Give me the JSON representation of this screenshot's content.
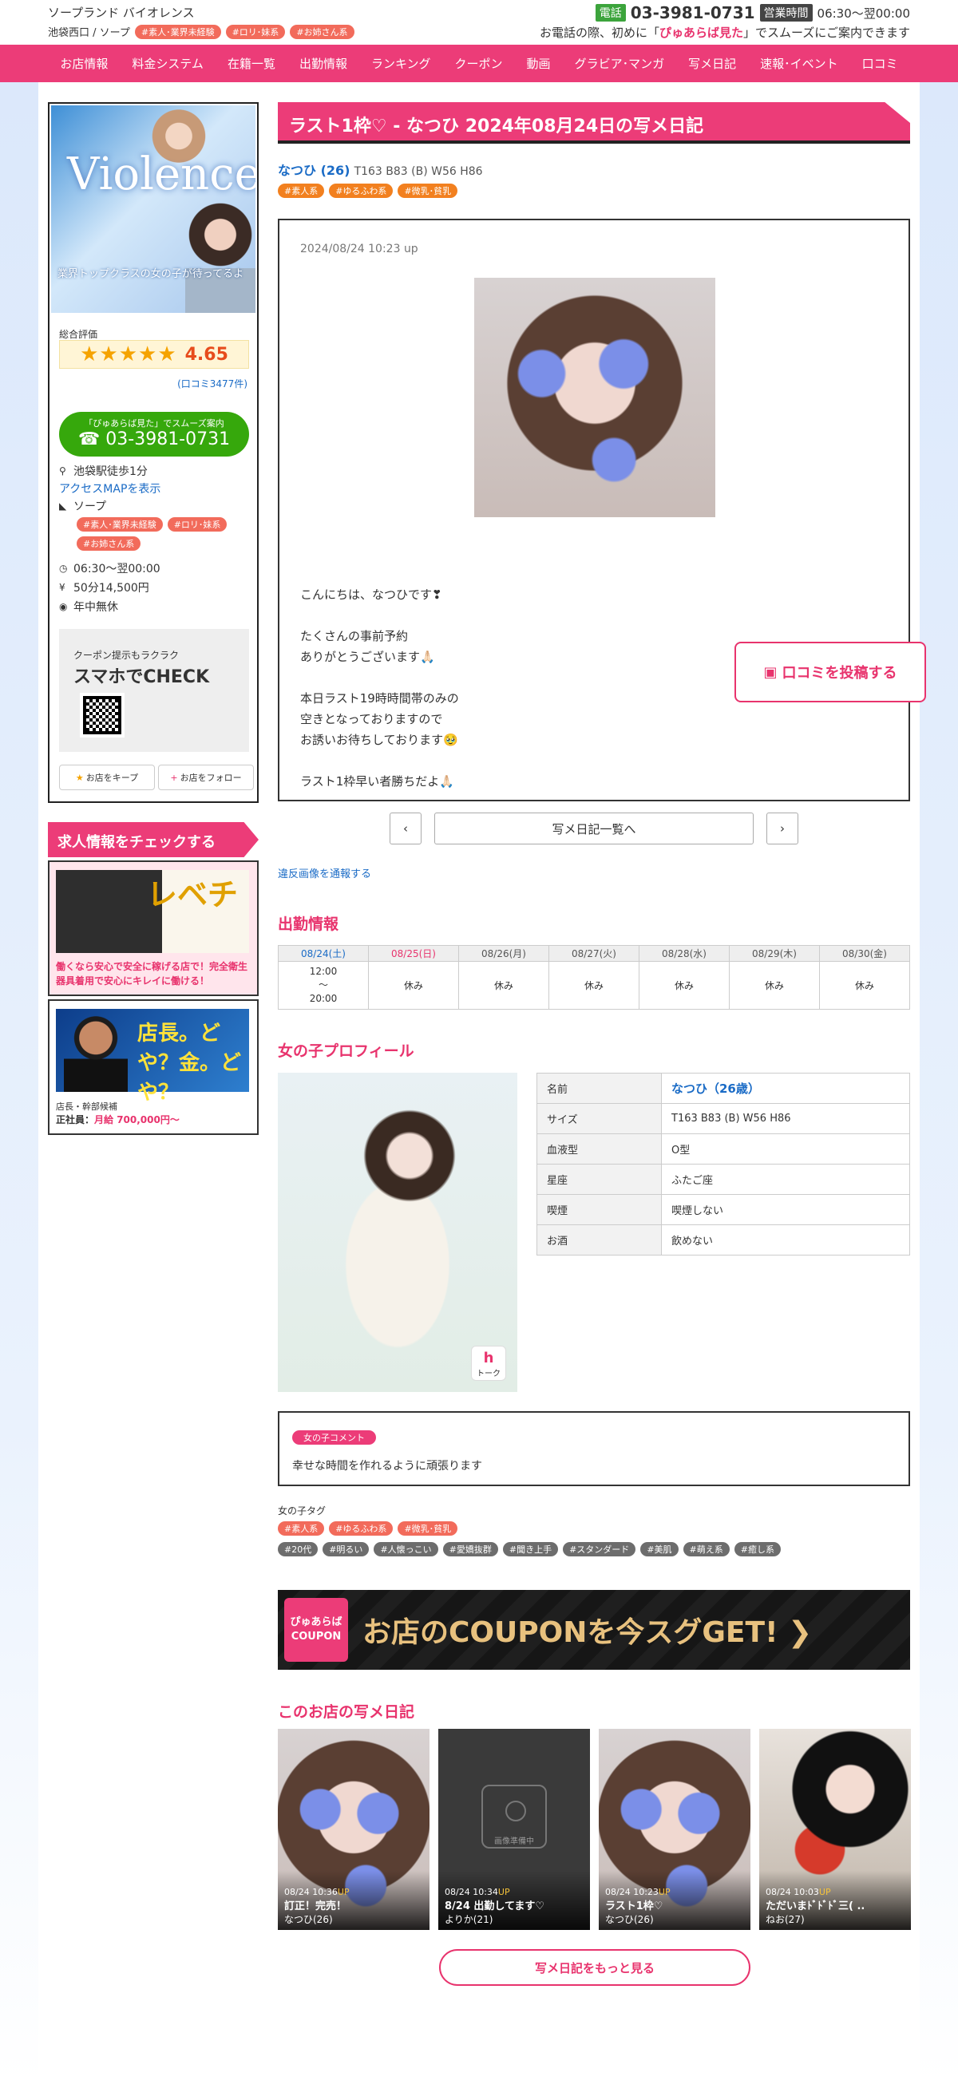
{
  "header": {
    "shop_title": "ソープランド バイオレンス",
    "shop_sub": "池袋西口 / ソープ",
    "shop_tags": [
      "#素人･業界未経験",
      "#ロリ･妹系",
      "#お姉さん系"
    ],
    "tel_label": "電話",
    "tel": "03-3981-0731",
    "hours_label": "営業時間",
    "hours": "06:30〜翌00:00",
    "notice_pre": "お電話の際、初めに「",
    "notice_key": "ぴゅあらば見た",
    "notice_post": "」でスムーズにご案内できます"
  },
  "nav": [
    "お店情報",
    "料金システム",
    "在籍一覧",
    "出勤情報",
    "ランキング",
    "クーポン",
    "動画",
    "グラビア･マンガ",
    "写メ日記",
    "速報･イベント",
    "口コミ"
  ],
  "sidebar": {
    "banner_logo": "Violence",
    "banner_caption": "業界トップクラスの女の子が待ってるよ",
    "eval_label": "総合評価",
    "stars": "★★★★★",
    "score": "4.65",
    "reviews": "(口コミ3477件)",
    "tel_small": "「ぴゅあらば見た」でスムーズ案内",
    "tel": "03-3981-0731",
    "access": "池袋駅徒歩1分",
    "map_link": "アクセスMAPを表示",
    "genre": "ソープ",
    "tags": [
      "#素人･業界未経験",
      "#ロリ･妹系",
      "#お姉さん系"
    ],
    "hours": "06:30〜翌00:00",
    "price": "50分14,500円",
    "holiday": "年中無休",
    "coupon_small": "クーポン提示もラクラク",
    "coupon_big": "スマホでCHECK",
    "keep": "お店をキープ",
    "follow": "お店をフォロー"
  },
  "recruit": {
    "title": "求人情報をチェックする",
    "card1_big": "レベチ",
    "card1_text": "働くなら安心で安全に稼げる店で！完全衛生器具着用で安心にキレイに働ける！",
    "card2_big": "店長。どや？金。どや？",
    "card2_role": "店長・幹部候補",
    "card2_pay_label": "正社員：",
    "card2_pay": "月給 700,000円〜"
  },
  "diary": {
    "title": "ラスト1枠♡ - なつひ 2024年08月24日の写メ日記",
    "name": "なつひ (26)",
    "spec": "T163 B83 (B) W56 H86",
    "tags": [
      "#素人系",
      "#ゆるふわ系",
      "#微乳･貧乳"
    ],
    "datetime": "2024/08/24 10:23 up",
    "body": "こんにちは、なつひです❣\n\nたくさんの事前予約\nありがとうございます🙏🏻\n\n本日ラスト19時時間帯のみの\n空きとなっておりますので\nお誘いお待ちしております🥹\n\nラスト1枠早い者勝ちだよ🙏🏻"
  },
  "post_review": "口コミを投稿する",
  "pager": {
    "prev": "‹",
    "list": "写メ日記一覧へ",
    "next": "›"
  },
  "report_link": "違反画像を通報する",
  "schedule": {
    "title": "出勤情報",
    "days": [
      "08/24(土)",
      "08/25(日)",
      "08/26(月)",
      "08/27(火)",
      "08/28(水)",
      "08/29(木)",
      "08/30(金)"
    ],
    "values": [
      "12:00\n〜\n20:00",
      "休み",
      "休み",
      "休み",
      "休み",
      "休み",
      "休み"
    ]
  },
  "profile": {
    "title": "女の子プロフィール",
    "rows": [
      {
        "k": "名前",
        "v": "なつひ（26歳）"
      },
      {
        "k": "サイズ",
        "v": "T163 B83 (B) W56 H86"
      },
      {
        "k": "血液型",
        "v": "O型"
      },
      {
        "k": "星座",
        "v": "ふたご座"
      },
      {
        "k": "喫煙",
        "v": "喫煙しない"
      },
      {
        "k": "お酒",
        "v": "飲めない"
      }
    ],
    "talk_badge": "トーク"
  },
  "comment": {
    "label": "女の子コメント",
    "text": "幸せな時間を作れるように頑張ります"
  },
  "girl_tags": {
    "label": "女の子タグ",
    "orange": [
      "#素人系",
      "#ゆるふわ系",
      "#微乳･貧乳"
    ],
    "gray": [
      "#20代",
      "#明るい",
      "#人懐っこい",
      "#愛嬌抜群",
      "#聞き上手",
      "#スタンダード",
      "#美肌",
      "#萌え系",
      "#癒し系"
    ]
  },
  "coupon_banner": {
    "logo": "ぴゅあらば COUPON",
    "text": "お店のCOUPONを今スグGET! ❯"
  },
  "shop_diary": {
    "title": "このお店の写メ日記",
    "placeholder": "画像準備中",
    "items": [
      {
        "time": "08/24 10:36",
        "up": "UP",
        "title": "訂正！完売！",
        "name": "なつひ(26)"
      },
      {
        "time": "08/24 10:34",
        "up": "UP",
        "title": "8/24 出勤してます♡",
        "name": "よりか(21)"
      },
      {
        "time": "08/24 10:23",
        "up": "UP",
        "title": "ラスト1枠♡",
        "name": "なつひ(26)"
      },
      {
        "time": "08/24 10:03",
        "up": "UP",
        "title": "ただいまﾄﾞﾄﾞﾄﾞ三(  ..",
        "name": "ねお(27)"
      }
    ],
    "more": "写メ日記をもっと見る"
  }
}
